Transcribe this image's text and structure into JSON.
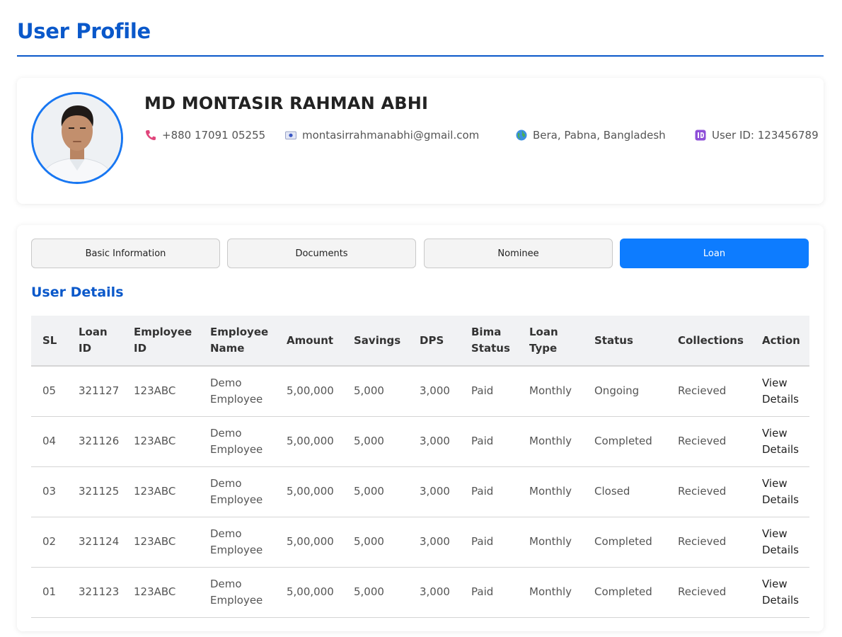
{
  "page": {
    "title": "User Profile"
  },
  "profile": {
    "name": "MD MONTASIR RAHMAN ABHI",
    "phone": "+880 17091 05255",
    "email": "montasirrahmanabhi@gmail.com",
    "location": "Bera, Pabna, Bangladesh",
    "user_id": "User ID: 123456789",
    "icons": {
      "phone": "phone-icon",
      "email": "email-icon",
      "location": "globe-icon",
      "id": "id-badge-icon"
    }
  },
  "tabs": [
    {
      "label": "Basic Information",
      "active": false
    },
    {
      "label": "Documents",
      "active": false
    },
    {
      "label": "Nominee",
      "active": false
    },
    {
      "label": "Loan",
      "active": true
    }
  ],
  "details": {
    "title": "User Details",
    "columns": [
      "SL",
      "Loan ID",
      "Employee ID",
      "Employee Name",
      "Amount",
      "Savings",
      "DPS",
      "Bima Status",
      "Loan Type",
      "Status",
      "Collections",
      "Action"
    ],
    "rows": [
      {
        "sl": "05",
        "loan_id": "321127",
        "employee_id": "123ABC",
        "employee_name": "Demo Employee",
        "amount": "5,00,000",
        "savings": "5,000",
        "dps": "3,000",
        "bima": "Paid",
        "loan_type": "Monthly",
        "status": "Ongoing",
        "collections": "Recieved",
        "action": "View Details"
      },
      {
        "sl": "04",
        "loan_id": "321126",
        "employee_id": "123ABC",
        "employee_name": "Demo Employee",
        "amount": "5,00,000",
        "savings": "5,000",
        "dps": "3,000",
        "bima": "Paid",
        "loan_type": "Monthly",
        "status": "Completed",
        "collections": "Recieved",
        "action": "View Details"
      },
      {
        "sl": "03",
        "loan_id": "321125",
        "employee_id": "123ABC",
        "employee_name": "Demo Employee",
        "amount": "5,00,000",
        "savings": "5,000",
        "dps": "3,000",
        "bima": "Paid",
        "loan_type": "Monthly",
        "status": "Closed",
        "collections": "Recieved",
        "action": "View Details"
      },
      {
        "sl": "02",
        "loan_id": "321124",
        "employee_id": "123ABC",
        "employee_name": "Demo Employee",
        "amount": "5,00,000",
        "savings": "5,000",
        "dps": "3,000",
        "bima": "Paid",
        "loan_type": "Monthly",
        "status": "Completed",
        "collections": "Recieved",
        "action": "View Details"
      },
      {
        "sl": "01",
        "loan_id": "321123",
        "employee_id": "123ABC",
        "employee_name": "Demo Employee",
        "amount": "5,00,000",
        "savings": "5,000",
        "dps": "3,000",
        "bima": "Paid",
        "loan_type": "Monthly",
        "status": "Completed",
        "collections": "Recieved",
        "action": "View Details"
      }
    ]
  },
  "colors": {
    "accent": "#0a58ca",
    "active_tab": "#0d7cff",
    "avatar_ring": "#1877f2"
  }
}
